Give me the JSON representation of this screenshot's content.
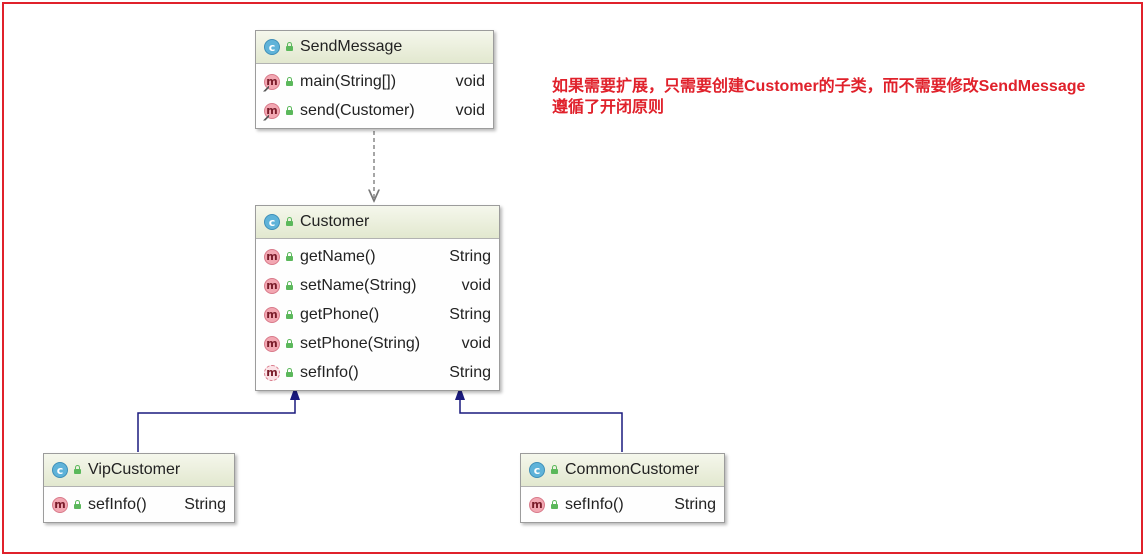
{
  "classes": [
    {
      "name": "SendMessage",
      "members": [
        {
          "sig": "main(String[])",
          "ret": "void",
          "kind": "static"
        },
        {
          "sig": "send(Customer)",
          "ret": "void",
          "kind": "static"
        }
      ]
    },
    {
      "name": "Customer",
      "members": [
        {
          "sig": "getName()",
          "ret": "String",
          "kind": "method"
        },
        {
          "sig": "setName(String)",
          "ret": "void",
          "kind": "method"
        },
        {
          "sig": "getPhone()",
          "ret": "String",
          "kind": "method"
        },
        {
          "sig": "setPhone(String)",
          "ret": "void",
          "kind": "method"
        },
        {
          "sig": "sefInfo()",
          "ret": "String",
          "kind": "override"
        }
      ]
    },
    {
      "name": "VipCustomer",
      "members": [
        {
          "sig": "sefInfo()",
          "ret": "String",
          "kind": "method"
        }
      ]
    },
    {
      "name": "CommonCustomer",
      "members": [
        {
          "sig": "sefInfo()",
          "ret": "String",
          "kind": "method"
        }
      ]
    }
  ],
  "icons": {
    "class": "c",
    "method": "m"
  },
  "note": {
    "line1": "如果需要扩展，只需要创建Customer的子类，而不需要修改SendMessage",
    "line2": "遵循了开闭原则"
  },
  "relations": [
    {
      "type": "dependency",
      "from": "SendMessage",
      "to": "Customer"
    },
    {
      "type": "inheritance",
      "from": "VipCustomer",
      "to": "Customer"
    },
    {
      "type": "inheritance",
      "from": "CommonCustomer",
      "to": "Customer"
    }
  ],
  "colors": {
    "frame": "#e0212b",
    "note": "#e0212b",
    "inheritance": "#1a1a7e",
    "dependency": "#777777"
  }
}
